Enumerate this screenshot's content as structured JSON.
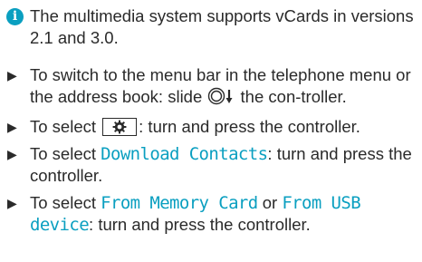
{
  "info": {
    "icon": "info-icon",
    "icon_glyph": "i",
    "text": "The multimedia system supports vCards in versions 2.1 and 3.0."
  },
  "steps": [
    {
      "before": "To switch to the menu bar in the telephone menu or the address book: slide ",
      "symbol": "controller-slide-down-icon",
      "after": " the con-troller."
    },
    {
      "before": "To select ",
      "symbol": "settings-gear-icon",
      "after": ": turn and press the controller."
    },
    {
      "before": "To select ",
      "display": "Download Contacts",
      "after": ": turn and press the controller."
    },
    {
      "before": "To select ",
      "display": "From Memory Card",
      "middle": " or ",
      "display2": "From USB device",
      "after": ": turn and press the controller."
    }
  ],
  "bullet_glyph": "▶",
  "colors": {
    "accent": "#0a9fc0",
    "text": "#2a2a2a"
  }
}
